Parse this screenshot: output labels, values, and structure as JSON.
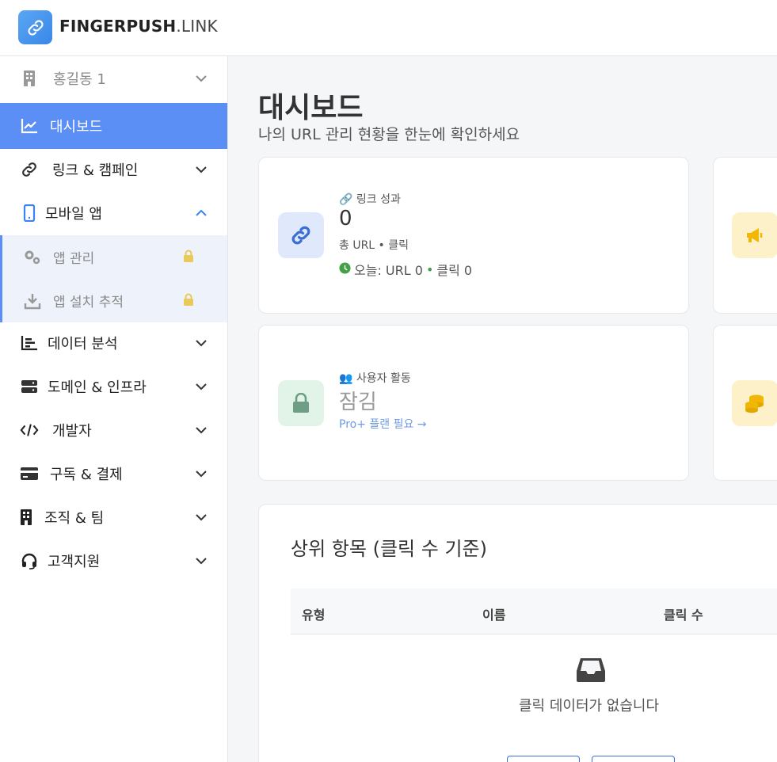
{
  "brand": {
    "name_bold": "FINGERPUSH",
    "name_light": ".LINK"
  },
  "sidebar": {
    "org": {
      "label": "홍길동 1"
    },
    "items": [
      {
        "label": "대시보드"
      },
      {
        "label": "링크 & 캠페인"
      },
      {
        "label": "모바일 앱"
      },
      {
        "label": "앱 관리"
      },
      {
        "label": "앱 설치 추적"
      },
      {
        "label": "데이터 분석"
      },
      {
        "label": "도메인 & 인프라"
      },
      {
        "label": "개발자"
      },
      {
        "label": "구독 & 결제"
      },
      {
        "label": "조직 & 팀"
      },
      {
        "label": "고객지원"
      }
    ]
  },
  "main": {
    "title": "대시보드",
    "subtitle": "나의 URL 관리 현황을 한눈에 확인하세요",
    "cards": {
      "link_perf": {
        "label": "링크 성과",
        "value": "0",
        "desc": "총 URL • 클릭",
        "today_prefix": "오늘: URL 0",
        "today_sep": "•",
        "today_suffix": "클릭 0"
      },
      "user_activity": {
        "label": "사용자 활동",
        "value": "잠김",
        "link": "Pro+ 플랜 필요 →"
      }
    },
    "top_items": {
      "title": "상위 항목 (클릭 수 기준)",
      "columns": [
        "유형",
        "이름",
        "클릭 수"
      ],
      "empty_text": "클릭 데이터가 없습니다"
    }
  },
  "colors": {
    "accent": "#5b8ff5",
    "link_icon": "#3b6fd4",
    "lock_icon": "#e9c95a",
    "green": "#43a047",
    "yellow_icon": "#f2b705"
  }
}
